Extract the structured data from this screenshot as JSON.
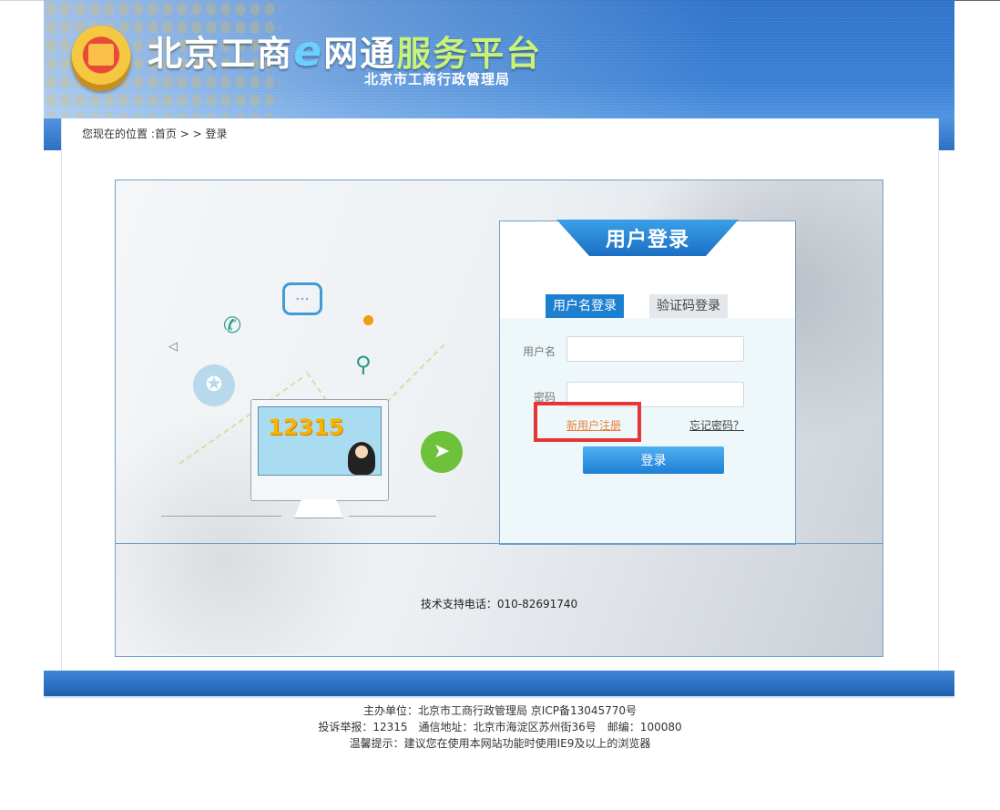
{
  "header": {
    "title_part1": "北京工商",
    "title_e": "e",
    "title_part2": "网通",
    "title_part3": "服务平台",
    "subtitle": "北京市工商行政管理局"
  },
  "breadcrumb": {
    "prefix": "您现在的位置 :",
    "home": "首页",
    "separator": "> >",
    "current": "登录"
  },
  "illustration": {
    "hotline": "12315"
  },
  "login": {
    "title": "用户登录",
    "tabs": [
      "用户名登录",
      "验证码登录"
    ],
    "username_label": "用户名",
    "username_value": "",
    "password_label": "密码",
    "password_value": "",
    "register_link": "新用户注册",
    "forgot_link": "忘记密码？",
    "submit_label": "登录"
  },
  "support": {
    "text": "技术支持电话：010-82691740"
  },
  "footer": {
    "line1": "主办单位：北京市工商行政管理局 京ICP备13045770号",
    "line2": "投诉举报：12315　通信地址：北京市海淀区苏州街36号　邮编：100080",
    "line3": "温馨提示：建议您在使用本网站功能时使用IE9及以上的浏览器"
  },
  "colors": {
    "header_blue": "#3a80d4",
    "accent_blue": "#1d7fd0",
    "register_orange": "#e8823a",
    "highlight_red": "#e53535"
  }
}
